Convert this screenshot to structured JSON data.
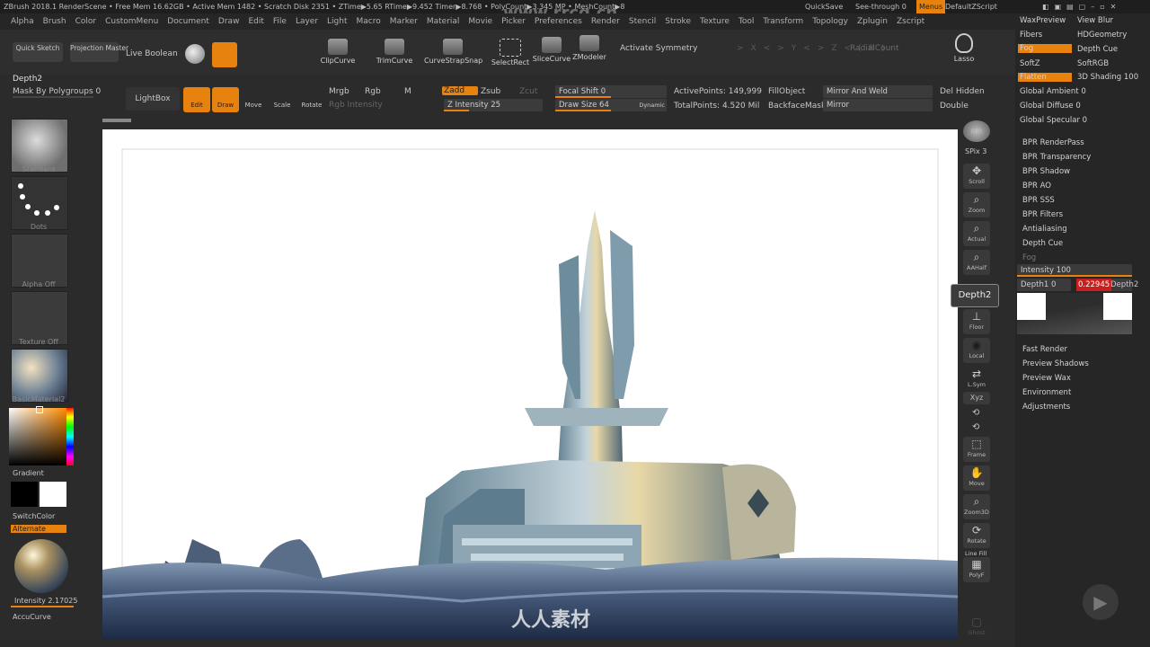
{
  "titlebar": {
    "text": "ZBrush 2018.1   RenderScene  • Free Mem 16.62GB • Active Mem 1482 • Scratch Disk 2351 • ZTime▶5.65 RTime▶9.452 Timer▶8.768 • PolyCount▶3.345 MP • MeshCount▶8",
    "watermark": "www.rrcg.cn",
    "quicksave": "QuickSave",
    "seethrough": "See-through  0",
    "menus": "Menus",
    "default_script": "DefaultZScript"
  },
  "menubar": [
    "Alpha",
    "Brush",
    "Color",
    "CustomMenu",
    "Document",
    "Draw",
    "Edit",
    "File",
    "Layer",
    "Light",
    "Macro",
    "Marker",
    "Material",
    "Movie",
    "Picker",
    "Preferences",
    "Render",
    "Stencil",
    "Stroke",
    "Texture",
    "Tool",
    "Transform",
    "Topology",
    "Zplugin",
    "Zscript"
  ],
  "shelf": {
    "quick_sketch": "Quick Sketch",
    "projection_master": "Projection Master",
    "live_boolean": "Live Boolean",
    "buttons": [
      "ClipCurve",
      "TrimCurve",
      "CurveStrapSnap",
      "SelectRect",
      "SliceCurve",
      "ZModeler"
    ],
    "activate_symmetry": "Activate Symmetry",
    "radial_count": "RadialCount",
    "lasso": "Lasso"
  },
  "toolbar2": {
    "depth_label": "Depth2",
    "mask_polygroups": "Mask By Polygroups 0",
    "lightbox": "LightBox",
    "edit": "Edit",
    "draw": "Draw",
    "move": "Move",
    "scale": "Scale",
    "rotate": "Rotate",
    "mrgb": "Mrgb",
    "rgb": "Rgb",
    "m": "M",
    "rgb_intensity": "Rgb Intensity",
    "zadd": "Zadd",
    "zsub": "Zsub",
    "zcut": "Zcut",
    "z_intensity": "Z Intensity 25",
    "focal_shift": "Focal Shift 0",
    "draw_size": "Draw Size 64",
    "dynamic": "Dynamic",
    "active_points": "ActivePoints: 149,999",
    "total_points": "TotalPoints: 4.520 Mil",
    "fill_object": "FillObject",
    "backface_mask": "BackfaceMask",
    "mirror_weld": "Mirror And Weld",
    "mirror": "Mirror",
    "del_hidden": "Del Hidden",
    "double": "Double"
  },
  "lefttray": {
    "standard": "Standard",
    "dots": "Dots",
    "alpha_off": "Alpha Off",
    "texture_off": "Texture Off",
    "material": "BasicMaterial2",
    "gradient": "Gradient",
    "switch_color": "SwitchColor",
    "alternate": "Alternate",
    "intensity": "Intensity 2.17025",
    "accucurve": "AccuCurve"
  },
  "righttray": {
    "bpr": "BPR",
    "spix": "SPix 3",
    "buttons": [
      "Scroll",
      "Zoom",
      "Actual",
      "AAHalf"
    ],
    "tooltip": "Depth2",
    "floor": "Floor",
    "local": "Local",
    "lsym": "L.Sym",
    "xyz": "Xyz",
    "lower_buttons": [
      "Frame",
      "Move",
      "Zoom3D",
      "Rotate"
    ],
    "linefill": "Line Fill",
    "polyf": "PolyF",
    "ghost": "Ghost"
  },
  "render": {
    "row1": [
      "WaxPreview",
      "View Blur"
    ],
    "row2": [
      "Fibers",
      "HDGeometry"
    ],
    "row3": [
      "Fog",
      "Depth Cue"
    ],
    "row4": [
      "SoftZ",
      "SoftRGB"
    ],
    "row5": [
      "Flatten",
      "3D Shading 100"
    ],
    "sliders": [
      "Global Ambient 0",
      "Global Diffuse 0",
      "Global Specular 0"
    ],
    "items": [
      "BPR RenderPass",
      "BPR Transparency",
      "BPR Shadow",
      "BPR AO",
      "BPR SSS",
      "BPR Filters",
      "Antialiasing",
      "Depth Cue"
    ],
    "fog_title": "Fog",
    "fog_intensity": "Intensity 100",
    "depth1": "Depth1 0",
    "depth2_value": "0.22945",
    "depth2_label": "Depth2",
    "items2": [
      "Fast Render",
      "Preview Shadows",
      "Preview Wax",
      "Environment",
      "Adjustments"
    ]
  },
  "watermark_bottom": "人人素材",
  "colors": {
    "accent": "#e8820f",
    "panel": "#2b2b2b",
    "canvas": "#ffffff",
    "danger": "#c81e1e"
  },
  "progress": {
    "z_intensity": 0.25,
    "focal_shift": 0.5,
    "draw_size": 0.5,
    "fog_intensity": 1.0,
    "depth2": 0.22945
  }
}
